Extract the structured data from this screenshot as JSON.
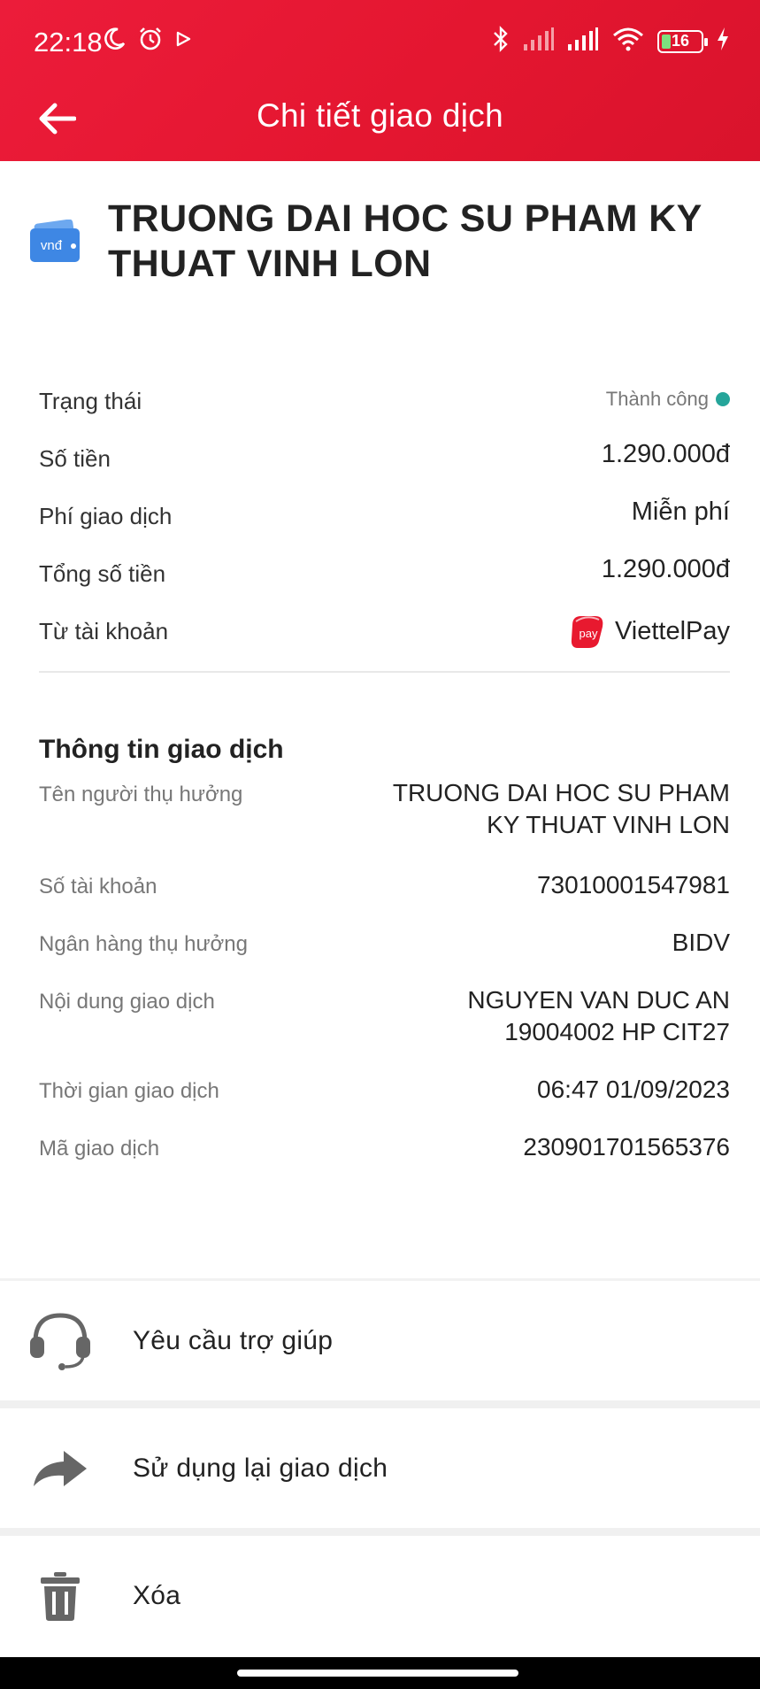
{
  "status_bar": {
    "time": "22:18",
    "battery": "16",
    "icons": [
      "moon-icon",
      "alarm-icon",
      "play-icon",
      "bluetooth-icon",
      "signal-icon",
      "signal-icon",
      "wifi-icon",
      "battery-icon",
      "charging-icon"
    ]
  },
  "header": {
    "title": "Chi tiết giao dịch",
    "color": "#e8192f"
  },
  "merchant": {
    "icon_text": "vnđ",
    "name_line1": "TRUONG DAI HOC SU PHAM KY",
    "name_line2": "THUAT VINH LON"
  },
  "summary": {
    "status_label": "Trạng thái",
    "status_value": "Thành công",
    "status_color": "#25a59a",
    "amount_label": "Số tiền",
    "amount_value": "1.290.000đ",
    "fee_label": "Phí giao dịch",
    "fee_value": "Miễn phí",
    "total_label": "Tổng số tiền",
    "total_value": "1.290.000đ",
    "from_label": "Từ tài khoản",
    "from_value": "ViettelPay"
  },
  "info": {
    "title": "Thông tin giao dịch",
    "beneficiary_label": "Tên người thụ hưởng",
    "beneficiary_line1": "TRUONG DAI HOC SU PHAM",
    "beneficiary_line2": "KY THUAT VINH LON",
    "account_label": "Số tài khoản",
    "account_value": "73010001547981",
    "bank_label": "Ngân hàng thụ hưởng",
    "bank_value": "BIDV",
    "content_label": "Nội dung giao dịch",
    "content_line1": "NGUYEN VAN DUC AN",
    "content_line2": "19004002 HP CIT27",
    "time_label": "Thời gian giao dịch",
    "time_value": "06:47 01/09/2023",
    "code_label": "Mã giao dịch",
    "code_value": "230901701565376"
  },
  "actions": {
    "help": "Yêu cầu trợ giúp",
    "reuse": "Sử dụng lại giao dịch",
    "delete": "Xóa"
  }
}
